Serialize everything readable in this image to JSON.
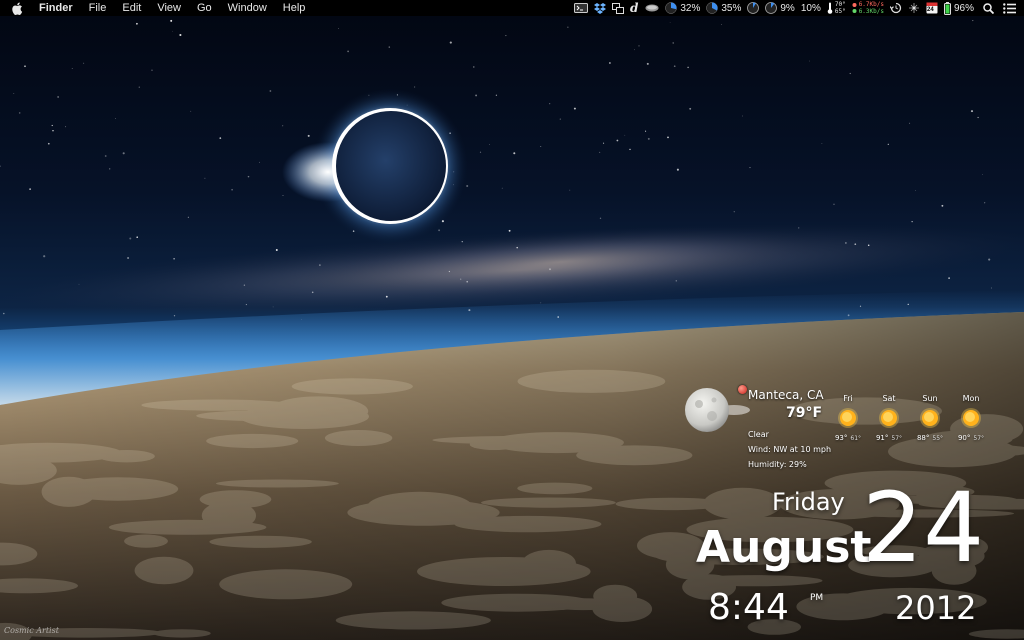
{
  "menubar": {
    "app_menu": "Finder",
    "menus": [
      "File",
      "Edit",
      "View",
      "Go",
      "Window",
      "Help"
    ],
    "status": {
      "cpu_percent": "32%",
      "memory_percent": "35%",
      "disk_percent": "9%",
      "other_percent": "10%",
      "temp_top": "70°",
      "temp_bottom": "65°",
      "net_up": "6.7Kb/s",
      "net_down": "6.3Kb/s",
      "calendar_day": "24",
      "battery_percent": "96%"
    }
  },
  "weather": {
    "location": "Manteca, CA",
    "current_temp": "79°F",
    "condition": "Clear",
    "wind": "Wind: NW at 10 mph",
    "humidity": "Humidity: 29%",
    "forecast": [
      {
        "day": "Fri",
        "high": "93°",
        "low": "61°"
      },
      {
        "day": "Sat",
        "high": "91°",
        "low": "57°"
      },
      {
        "day": "Sun",
        "high": "88°",
        "low": "55°"
      },
      {
        "day": "Mon",
        "high": "90°",
        "low": "57°"
      }
    ]
  },
  "datetime": {
    "weekday": "Friday",
    "month": "August",
    "day": "24",
    "time": "8:44",
    "ampm": "PM",
    "year": "2012"
  },
  "wallpaper": {
    "signature": "Cosmic Artist"
  },
  "colors": {
    "menubar_bg": "#000000",
    "net_up": "#ff6a5e",
    "net_down": "#63d76a"
  }
}
